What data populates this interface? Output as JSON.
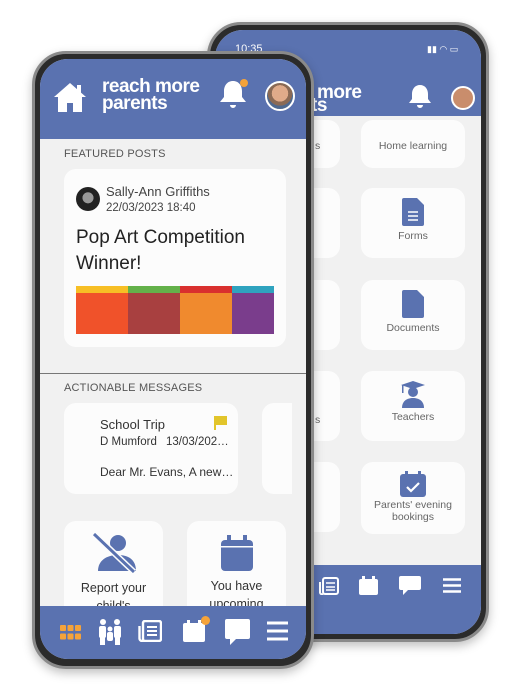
{
  "colors": {
    "brand": "#5a72b0",
    "accent": "#f5a33a",
    "flag": "#e2c52b"
  },
  "back_phone": {
    "status_time": "10:35",
    "logo_partial": {
      "line1": "more",
      "line2": "ts"
    },
    "tiles": [
      {
        "label": "Home learning",
        "icon": "home-learning-icon"
      },
      {
        "label": "Forms",
        "icon": "form-document-icon"
      },
      {
        "label": "Documents",
        "icon": "document-icon"
      },
      {
        "label": "Teachers",
        "icon": "teacher-icon"
      },
      {
        "label": "Parents' evening bookings",
        "icon": "calendar-check-icon"
      }
    ],
    "left_tile_fragments": [
      "s",
      "s"
    ]
  },
  "front_phone": {
    "logo": {
      "line1": "reach more",
      "line2": "parents"
    },
    "featured_label": "FEATURED POSTS",
    "post": {
      "author": "Sally-Ann Griffiths",
      "date": "22/03/2023 18:40",
      "title": "Pop Art Competition Winner!"
    },
    "actionable_label": "ACTIONABLE MESSAGES",
    "message": {
      "subject": "School Trip",
      "sender": "D Mumford",
      "date": "13/03/202…",
      "preview": "Dear Mr. Evans, A new…"
    },
    "tiles": [
      {
        "label": "Report your child's",
        "icon": "absence-icon"
      },
      {
        "label": "You have upcoming",
        "icon": "calendar-icon"
      }
    ],
    "nav": [
      "dashboard-icon",
      "family-icon",
      "newsletter-icon",
      "calendar-icon",
      "chat-icon",
      "menu-icon"
    ]
  }
}
